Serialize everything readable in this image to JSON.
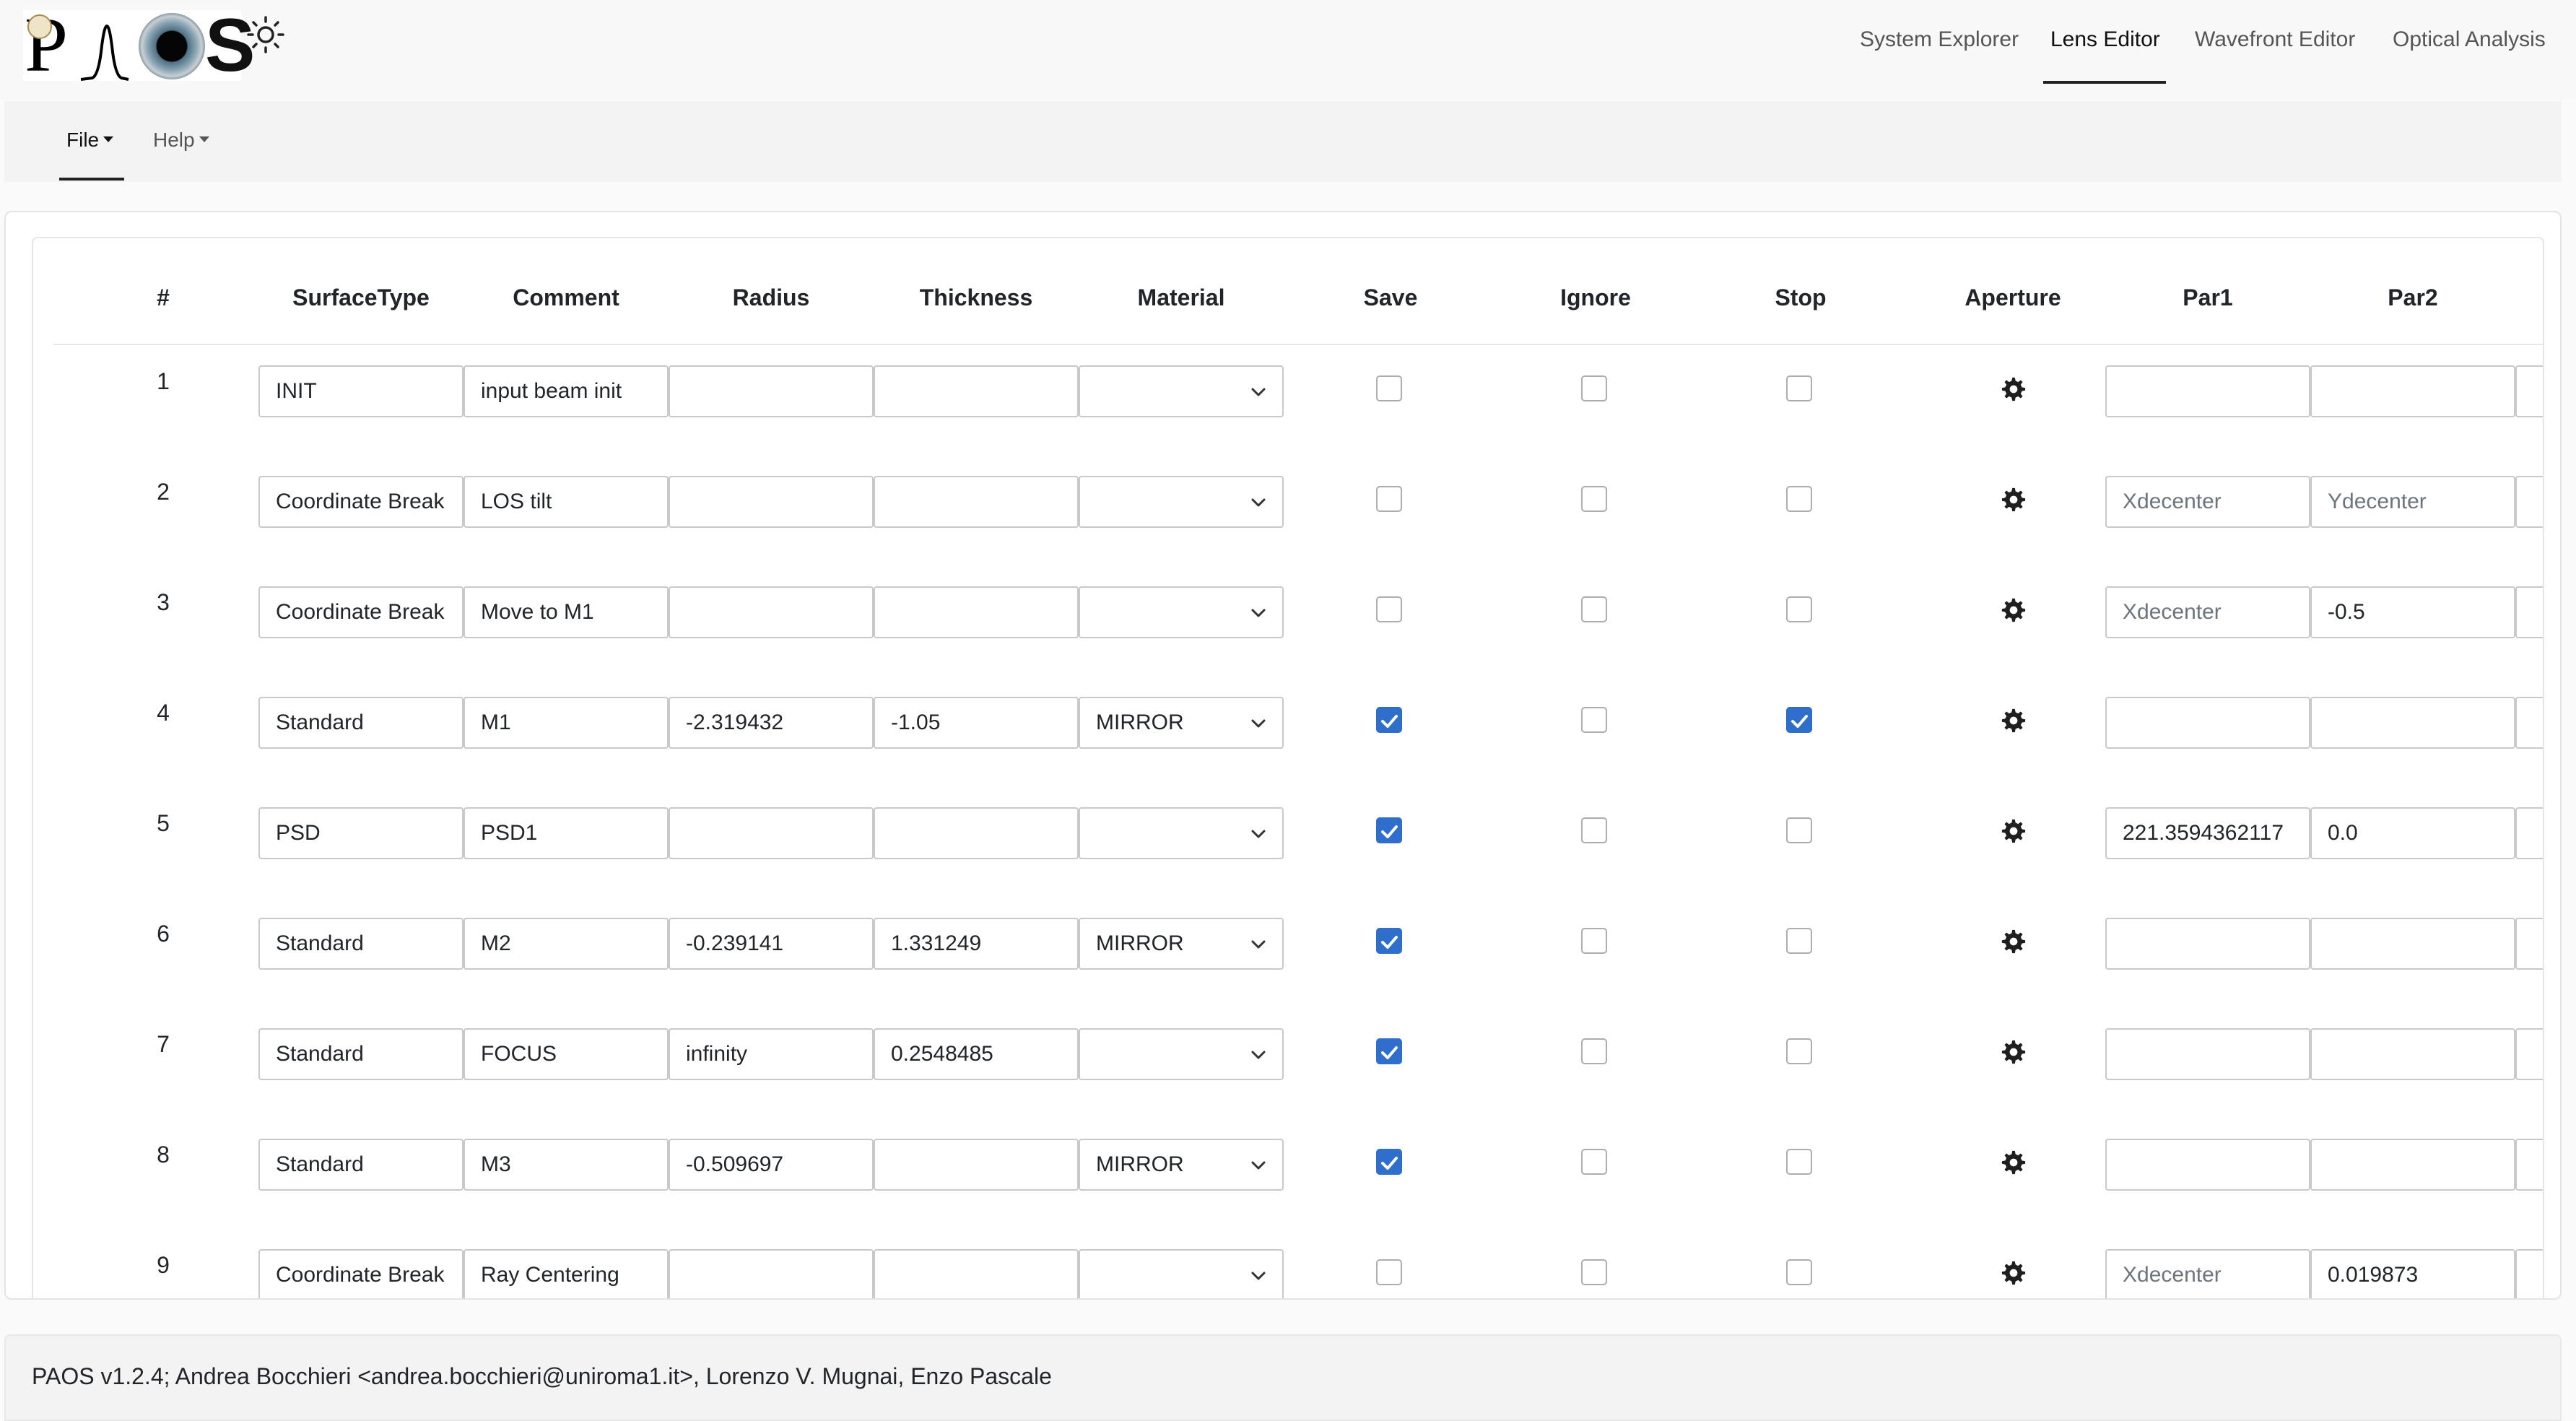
{
  "app": {
    "logo_text": "PAOS"
  },
  "nav": {
    "items": [
      {
        "label": "System Explorer"
      },
      {
        "label": "Lens Editor"
      },
      {
        "label": "Wavefront Editor"
      },
      {
        "label": "Optical Analysis"
      }
    ],
    "active": "Lens Editor"
  },
  "menu": {
    "file": "File",
    "help": "Help"
  },
  "table": {
    "headers": [
      "#",
      "SurfaceType",
      "Comment",
      "Radius",
      "Thickness",
      "Material",
      "Save",
      "Ignore",
      "Stop",
      "Aperture",
      "Par1",
      "Par2"
    ],
    "rows": [
      {
        "num": "1",
        "surface_type": "INIT",
        "comment": "input beam init",
        "radius": "",
        "thickness": "",
        "material": "",
        "save": false,
        "ignore": false,
        "stop": false,
        "par1": "",
        "par1_placeholder": "",
        "par2": "",
        "par2_placeholder": ""
      },
      {
        "num": "2",
        "surface_type": "Coordinate Break",
        "comment": "LOS tilt",
        "radius": "",
        "thickness": "",
        "material": "",
        "save": false,
        "ignore": false,
        "stop": false,
        "par1": "",
        "par1_placeholder": "Xdecenter",
        "par2": "",
        "par2_placeholder": "Ydecenter"
      },
      {
        "num": "3",
        "surface_type": "Coordinate Break",
        "comment": "Move to M1",
        "radius": "",
        "thickness": "",
        "material": "",
        "save": false,
        "ignore": false,
        "stop": false,
        "par1": "",
        "par1_placeholder": "Xdecenter",
        "par2": "-0.5",
        "par2_placeholder": ""
      },
      {
        "num": "4",
        "surface_type": "Standard",
        "comment": "M1",
        "radius": "-2.319432",
        "thickness": "-1.05",
        "material": "MIRROR",
        "save": true,
        "ignore": false,
        "stop": true,
        "par1": "",
        "par1_placeholder": "",
        "par2": "",
        "par2_placeholder": ""
      },
      {
        "num": "5",
        "surface_type": "PSD",
        "comment": "PSD1",
        "radius": "",
        "thickness": "",
        "material": "",
        "save": true,
        "ignore": false,
        "stop": false,
        "par1": "221.3594362117",
        "par1_placeholder": "",
        "par2": "0.0",
        "par2_placeholder": ""
      },
      {
        "num": "6",
        "surface_type": "Standard",
        "comment": "M2",
        "radius": "-0.239141",
        "thickness": "1.331249",
        "material": "MIRROR",
        "save": true,
        "ignore": false,
        "stop": false,
        "par1": "",
        "par1_placeholder": "",
        "par2": "",
        "par2_placeholder": ""
      },
      {
        "num": "7",
        "surface_type": "Standard",
        "comment": "FOCUS",
        "radius": "infinity",
        "thickness": "0.2548485",
        "material": "",
        "save": true,
        "ignore": false,
        "stop": false,
        "par1": "",
        "par1_placeholder": "",
        "par2": "",
        "par2_placeholder": ""
      },
      {
        "num": "8",
        "surface_type": "Standard",
        "comment": "M3",
        "radius": "-0.509697",
        "thickness": "",
        "material": "MIRROR",
        "save": true,
        "ignore": false,
        "stop": false,
        "par1": "",
        "par1_placeholder": "",
        "par2": "",
        "par2_placeholder": ""
      },
      {
        "num": "9",
        "surface_type": "Coordinate Break",
        "comment": "Ray Centering",
        "radius": "",
        "thickness": "",
        "material": "",
        "save": false,
        "ignore": false,
        "stop": false,
        "par1": "",
        "par1_placeholder": "Xdecenter",
        "par2": "0.019873",
        "par2_placeholder": ""
      }
    ]
  },
  "footer": {
    "text": "PAOS v1.2.4; Andrea Bocchieri <andrea.bocchieri@uniroma1.it>, Lorenzo V. Mugnai, Enzo Pascale"
  },
  "colors": {
    "accent": "#2f6fcb",
    "nav_active_underline": "#222222"
  },
  "icons": {
    "theme": "sun-icon",
    "aperture": "gear-icon",
    "select": "chevron-down-icon"
  }
}
